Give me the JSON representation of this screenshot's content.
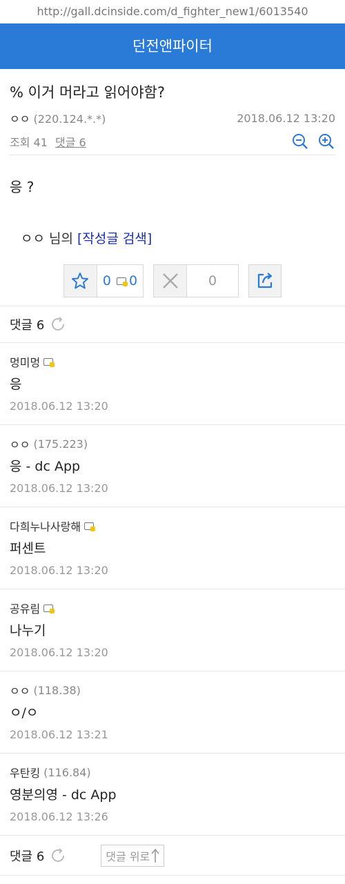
{
  "url": "http://gall.dcinside.com/d_fighter_new1/6013540",
  "gallery": "던전앤파이터",
  "post": {
    "title": "% 이거 머라고 읽어야함?",
    "author": "ㅇㅇ",
    "ip": "(220.124.*.*)",
    "date": "2018.06.12 13:20",
    "views": "조회 41",
    "comments": "댓글 6",
    "body": "응 ?",
    "author_search_nick": "ㅇㅇ",
    "author_search_suffix": " 님의 ",
    "author_search_link": "[작성글 검색]"
  },
  "votes": {
    "recommend": "0",
    "fix_recommend": "0",
    "not_recommend": "0"
  },
  "comment_header": "댓글 6",
  "comments": [
    {
      "author": "멍미멍",
      "ip": "",
      "fixed": true,
      "text": "응",
      "date": "2018.06.12 13:20"
    },
    {
      "author": "ㅇㅇ",
      "ip": "(175.223)",
      "fixed": false,
      "text": "응 - dc App",
      "date": "2018.06.12 13:20"
    },
    {
      "author": "다희누나사랑해",
      "ip": "",
      "fixed": true,
      "text": "퍼센트",
      "date": "2018.06.12 13:20"
    },
    {
      "author": "공유림",
      "ip": "",
      "fixed": true,
      "text": "나누기",
      "date": "2018.06.12 13:20"
    },
    {
      "author": "ㅇㅇ",
      "ip": "(118.38)",
      "fixed": false,
      "text": "ㅇ/ㅇ",
      "date": "2018.06.12 13:21"
    },
    {
      "author": "우탄킹",
      "ip": "(116.84)",
      "fixed": false,
      "text": "영분의영 - dc App",
      "date": "2018.06.12 13:26"
    }
  ],
  "footer": {
    "comment_count": "댓글 6",
    "top_label": "댓글 위로"
  },
  "colors": {
    "accent": "#2a7ad7",
    "link": "#1a2fb0"
  }
}
